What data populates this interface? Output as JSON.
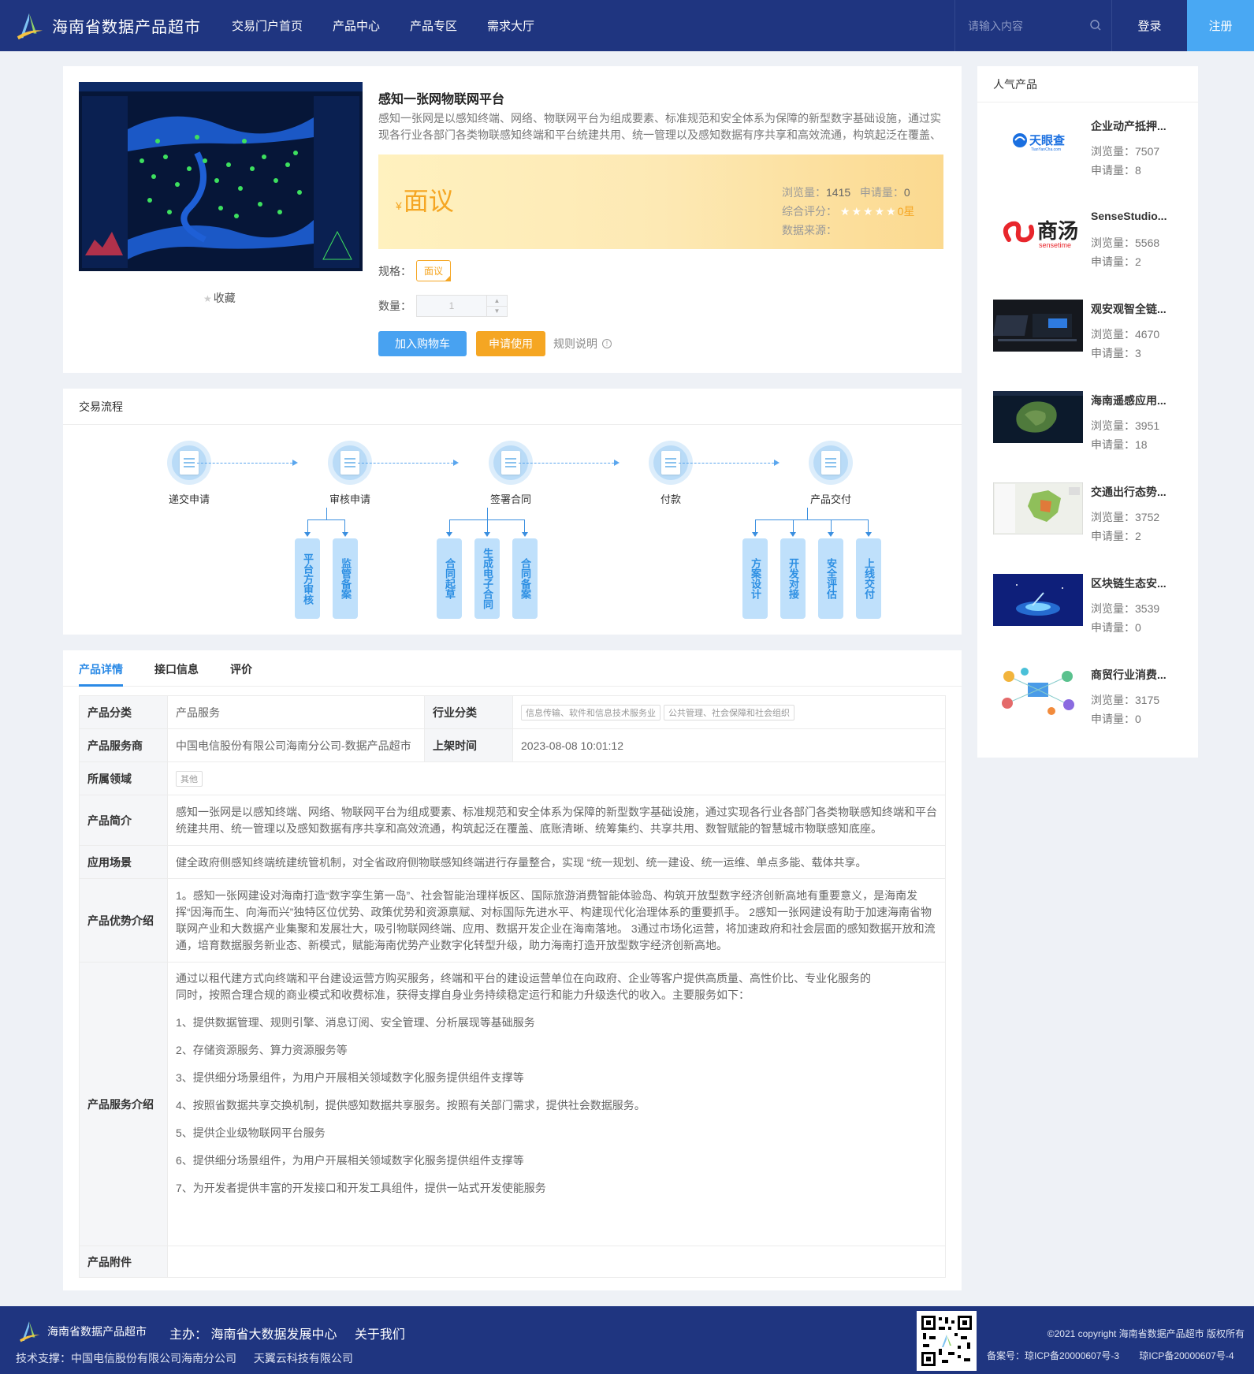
{
  "header": {
    "site_name": "海南省数据产品超市",
    "nav": [
      "交易门户首页",
      "产品中心",
      "产品专区",
      "需求大厅"
    ],
    "search_placeholder": "请输入内容",
    "login": "登录",
    "register": "注册"
  },
  "product": {
    "collect": "收藏",
    "title": "感知一张网物联网平台",
    "description": "感知一张网是以感知终端、网络、物联网平台为组成要素、标准规范和安全体系为保障的新型数字基础设施，通过实现各行业各部门各类物联感知终端和平台统建共用、统一管理以及感知数据有序共享和高效流通，构筑起泛在覆盖、底账清晰、统筹集约、共享共用、数智赋能的智慧城市物联感知底座。",
    "price_symbol": "¥",
    "price": "面议",
    "views_label": "浏览量：",
    "views": "1415",
    "applies_label": "申请量：",
    "applies": "0",
    "rating_label": "综合评分：",
    "rating_stars": "★★★★★",
    "rating": "0星",
    "source_label": "数据来源：",
    "spec_label": "规格：",
    "spec_value": "面议",
    "qty_label": "数量：",
    "qty_value": "1",
    "add_cart": "加入购物车",
    "apply": "申请使用",
    "rules": "规则说明"
  },
  "flow": {
    "title": "交易流程",
    "steps": [
      "递交申请",
      "审核申请",
      "签署合同",
      "付款",
      "产品交付"
    ],
    "sub_steps": [
      "平台方审核",
      "监管备案",
      "合同起草",
      "生成电子合同",
      "合同备案",
      "方案设计",
      "开发对接",
      "安全评估",
      "上线交付"
    ]
  },
  "detail": {
    "tabs": [
      "产品详情",
      "接口信息",
      "评价"
    ],
    "rows": {
      "category_label": "产品分类",
      "category": "产品服务",
      "industry_label": "行业分类",
      "industry_tags": [
        "信息传输、软件和信息技术服务业",
        "公共管理、社会保障和社会组织"
      ],
      "provider_label": "产品服务商",
      "provider": "中国电信股份有限公司海南分公司-数据产品超市",
      "online_label": "上架时间",
      "online_time": "2023-08-08 10:01:12",
      "domain_label": "所属领域",
      "domain_tag": "其他",
      "intro_label": "产品简介",
      "intro": "感知一张网是以感知终端、网络、物联网平台为组成要素、标准规范和安全体系为保障的新型数字基础设施，通过实现各行业各部门各类物联感知终端和平台统建共用、统一管理以及感知数据有序共享和高效流通，构筑起泛在覆盖、底账清晰、统筹集约、共享共用、数智赋能的智慧城市物联感知底座。",
      "scene_label": "应用场景",
      "scene": "健全政府侧感知终端统建统管机制，对全省政府侧物联感知终端进行存量整合，实现 “统一规划、统一建设、统一运维、单点多能、载体共享。",
      "advantage_label": "产品优势介绍",
      "advantage": "1。感知一张网建设对海南打造“数字孪生第一岛”、社会智能治理样板区、国际旅游消费智能体验岛、构筑开放型数字经济创新高地有重要意义，是海南发挥“因海而生、向海而兴”独特区位优势、政策优势和资源禀赋、对标国际先进水平、构建现代化治理体系的重要抓手。 2感知一张网建设有助于加速海南省物联网产业和大数据产业集聚和发展壮大，吸引物联网终端、应用、数据开发企业在海南落地。 3通过市场化运营，将加速政府和社会层面的感知数据开放和流通，培育数据服务新业态、新模式，赋能海南优势产业数字化转型升级，助力海南打造开放型数字经济创新高地。",
      "service_label": "产品服务介绍",
      "service_intro": "通过以租代建方式向终端和平台建设运营方购买服务，终端和平台的建设运营单位在向政府、企业等客户提供高质量、高性价比、专业化服务的同时，按照合理合规的商业模式和收费标准，获得支撑自身业务持续稳定运行和能力升级迭代的收入。主要服务如下：",
      "service_items": [
        "1、提供数据管理、规则引擎、消息订阅、安全管理、分析展现等基础服务",
        "2、存储资源服务、算力资源服务等",
        "3、提供细分场景组件，为用户开展相关领域数字化服务提供组件支撑等",
        "4、按照省数据共享交换机制，提供感知数据共享服务。按照有关部门需求，提供社会数据服务。",
        "5、提供企业级物联网平台服务",
        "6、提供细分场景组件，为用户开展相关领域数字化服务提供组件支撑等",
        "7、为开发者提供丰富的开发接口和开发工具组件，提供一站式开发使能服务"
      ],
      "attach_label": "产品附件"
    }
  },
  "popular": {
    "title": "人气产品",
    "items": [
      {
        "name": "企业动产抵押...",
        "views": "浏览量：7507",
        "applies": "申请量：8",
        "thumb": "tianyancha"
      },
      {
        "name": "SenseStudio...",
        "views": "浏览量：5568",
        "applies": "申请量：2",
        "thumb": "sensetime"
      },
      {
        "name": "观安观智全链...",
        "views": "浏览量：4670",
        "applies": "申请量：3",
        "thumb": "dark-ui"
      },
      {
        "name": "海南遥感应用...",
        "views": "浏览量：3951",
        "applies": "申请量：18",
        "thumb": "satellite"
      },
      {
        "name": "交通出行态势...",
        "views": "浏览量：3752",
        "applies": "申请量：2",
        "thumb": "map"
      },
      {
        "name": "区块链生态安...",
        "views": "浏览量：3539",
        "applies": "申请量：0",
        "thumb": "blockchain"
      },
      {
        "name": "商贸行业消费...",
        "views": "浏览量：3175",
        "applies": "申请量：0",
        "thumb": "network"
      }
    ],
    "logo_texts": {
      "tianyancha": "天眼查",
      "tianyancha_sub": "TianYanCha.com",
      "sensetime": "商汤",
      "sensetime_sub": "sensetime"
    }
  },
  "footer": {
    "site_name": "海南省数据产品超市",
    "host": "主办： 海南省大数据发展中心",
    "about": "关于我们",
    "tech_label": "技术支撑：中国电信股份有限公司海南分公司",
    "tech2": "天翼云科技有限公司",
    "copyright": "©2021 copyright 海南省数据产品超市 版权所有",
    "icp1": "备案号：琼ICP备20000607号-3",
    "icp2": "琼ICP备20000607号-4"
  },
  "colors": {
    "primary": "#1f3580",
    "accent_blue": "#48a2f1",
    "accent_orange": "#f5a623"
  }
}
